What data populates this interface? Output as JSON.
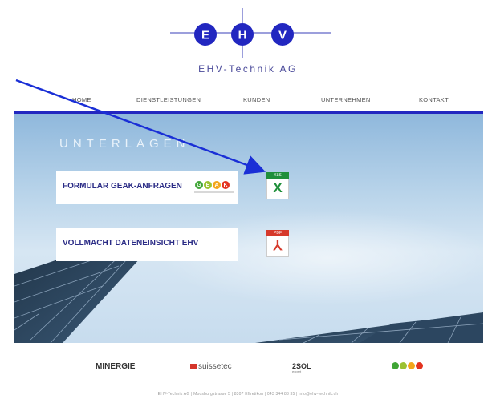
{
  "brand": {
    "letters": [
      "E",
      "H",
      "V"
    ],
    "name": "EHV-Technik AG"
  },
  "nav": {
    "items": [
      "HOME",
      "DIENSTLEISTUNGEN",
      "KUNDEN",
      "UNTERNEHMEN",
      "KONTAKT"
    ]
  },
  "hero": {
    "title": "UNTERLAGEN"
  },
  "documents": [
    {
      "label": "FORMULAR GEAK-ANFRAGEN",
      "badge_letters": [
        "G",
        "E",
        "A",
        "K"
      ],
      "file_type": "XLS",
      "file_glyph": "X",
      "file_icon": "excel-file-icon"
    },
    {
      "label": "VOLLMACHT DATENEINSICHT EHV",
      "file_type": "PDF",
      "file_glyph": "⅄",
      "file_icon": "pdf-file-icon"
    }
  ],
  "sponsors": [
    "MINERGIE",
    "suissetec",
    "2SOL",
    "GEAK"
  ],
  "sponsor_sub": {
    "2SOL": "expert"
  },
  "footer": "EHV-Technik AG | Moosburgstrasse 5 | 8307 Effretikon | 043 344 83 35 | info@ehv-technik.ch",
  "colors": {
    "brand_blue": "#2227c0",
    "card_text": "#2b2c86",
    "arrow": "#1a2fd6",
    "xls_green": "#1f8f3a",
    "pdf_red": "#d6392b"
  }
}
